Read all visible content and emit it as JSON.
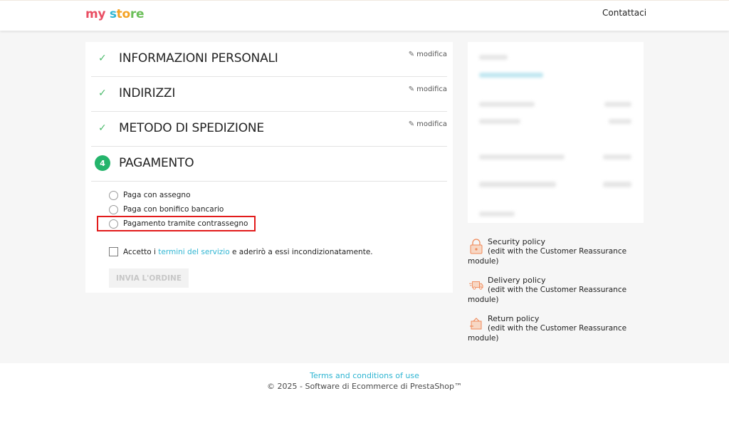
{
  "header": {
    "logo": {
      "part1": "my",
      "part2": "s",
      "part3": "to",
      "part4": "re"
    },
    "contact_label": "Contattaci"
  },
  "checkout": {
    "steps": [
      {
        "title": "Informazioni personali",
        "edit_label": "modifica",
        "done": true
      },
      {
        "title": "Indirizzi",
        "edit_label": "modifica",
        "done": true
      },
      {
        "title": "Metodo di spedizione",
        "edit_label": "modifica",
        "done": true
      },
      {
        "number": "4",
        "title": "Pagamento",
        "done": false
      }
    ],
    "payment_options": [
      {
        "label": "Paga con assegno",
        "selected": false
      },
      {
        "label": "Paga con bonifico bancario",
        "selected": false
      },
      {
        "label": "Pagamento tramite contrassegno",
        "selected": false,
        "highlighted": true
      }
    ],
    "terms": {
      "prefix": "Accetto i ",
      "link": "termini del servizio",
      "suffix": " e aderirò a essi incondizionatamente.",
      "checked": false
    },
    "order_button": "Invia l'ordine"
  },
  "reassurance": [
    {
      "title": "Security policy",
      "desc": "(edit with the Customer Reassurance module)",
      "icon": "lock-icon"
    },
    {
      "title": "Delivery policy",
      "desc": "(edit with the Customer Reassurance module)",
      "icon": "truck-icon"
    },
    {
      "title": "Return policy",
      "desc": "(edit with the Customer Reassurance module)",
      "icon": "return-icon"
    }
  ],
  "footer": {
    "link": "Terms and conditions of use",
    "copyright": "© 2025 - Software di Ecommerce di PrestaShop™"
  },
  "colors": {
    "accent": "#2fb5d2",
    "success": "#24b46b",
    "highlight": "#e21b1b",
    "background": "#f6f6f6"
  }
}
